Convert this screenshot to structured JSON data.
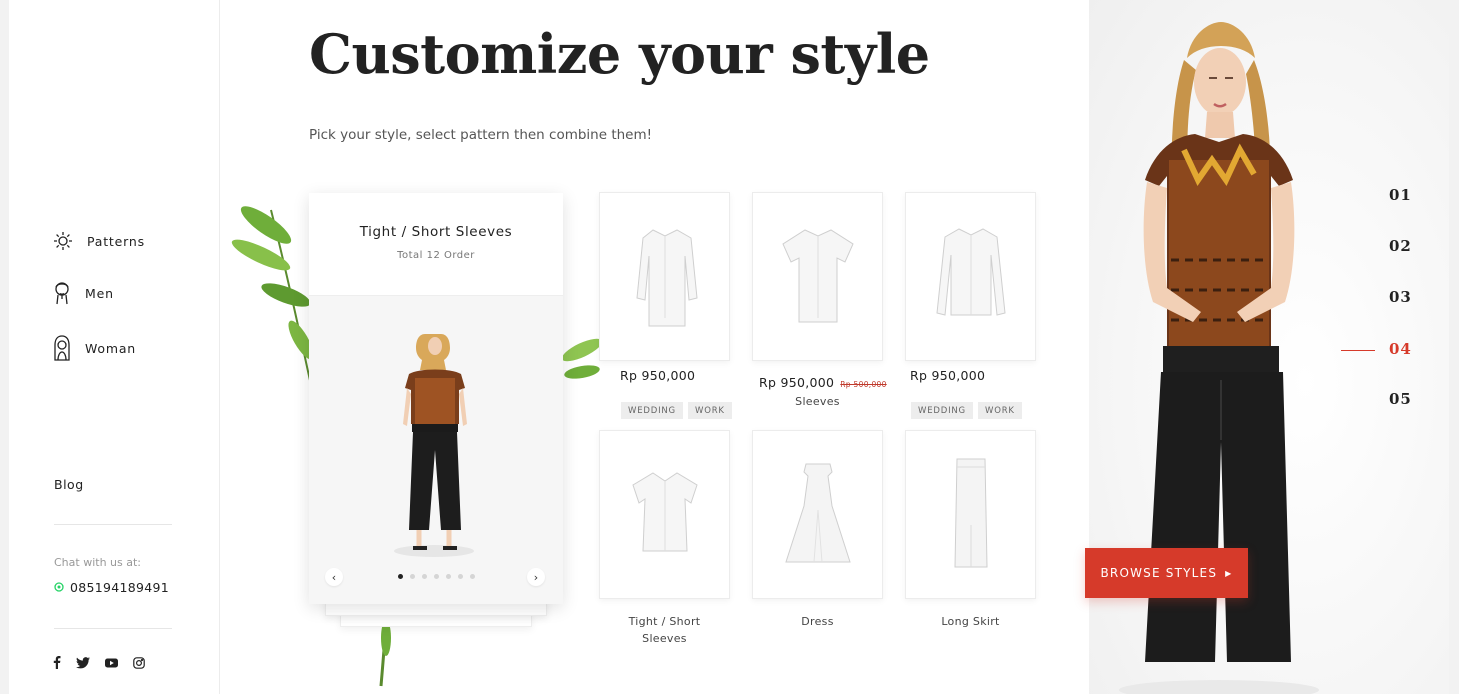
{
  "sidebar": {
    "items": [
      {
        "label": "Patterns",
        "icon": "pattern-icon"
      },
      {
        "label": "Men",
        "icon": "man-icon"
      },
      {
        "label": "Woman",
        "icon": "woman-icon"
      }
    ],
    "blog_label": "Blog",
    "chat_label": "Chat with us at:",
    "phone": "085194189491",
    "socials": [
      "facebook-icon",
      "twitter-icon",
      "youtube-icon",
      "instagram-icon"
    ]
  },
  "header": {
    "title_bold": "Customize",
    "title_rest": " your style",
    "subtitle": "Pick your style, select pattern then combine them!"
  },
  "featured": {
    "title": "Tight / Short Sleeves",
    "subtitle": "Total 12 Order",
    "prev_arrow": "‹",
    "next_arrow": "›",
    "dot_count": 7,
    "active_dot": 1
  },
  "products": [
    {
      "price": "Rp 950,000",
      "tags": [
        "WEDDING",
        "WORK"
      ],
      "icon": "long-sleeve-shirt-icon"
    },
    {
      "price": "Rp 950,000",
      "old_price": "Rp 500,000",
      "name": "Sleeves",
      "icon": "short-sleeve-shirt-icon"
    },
    {
      "price": "Rp 950,000",
      "tags": [
        "WEDDING",
        "WORK"
      ],
      "icon": "long-sleeve-blouse-icon"
    },
    {
      "name_line1": "Tight / Short",
      "name_line2": "Sleeves",
      "icon": "short-sleeve-blouse-icon"
    },
    {
      "name": "Dress",
      "icon": "dress-icon"
    },
    {
      "name": "Long Skirt",
      "icon": "long-skirt-icon"
    }
  ],
  "slides": {
    "numbers": [
      "01",
      "02",
      "03",
      "04",
      "05"
    ],
    "active": "04"
  },
  "cta": {
    "label": "BROWSE STYLES",
    "arrow": "▶"
  },
  "colors": {
    "accent": "#d63a2a",
    "text": "#222222",
    "muted": "#999999",
    "whatsapp": "#25d366"
  }
}
